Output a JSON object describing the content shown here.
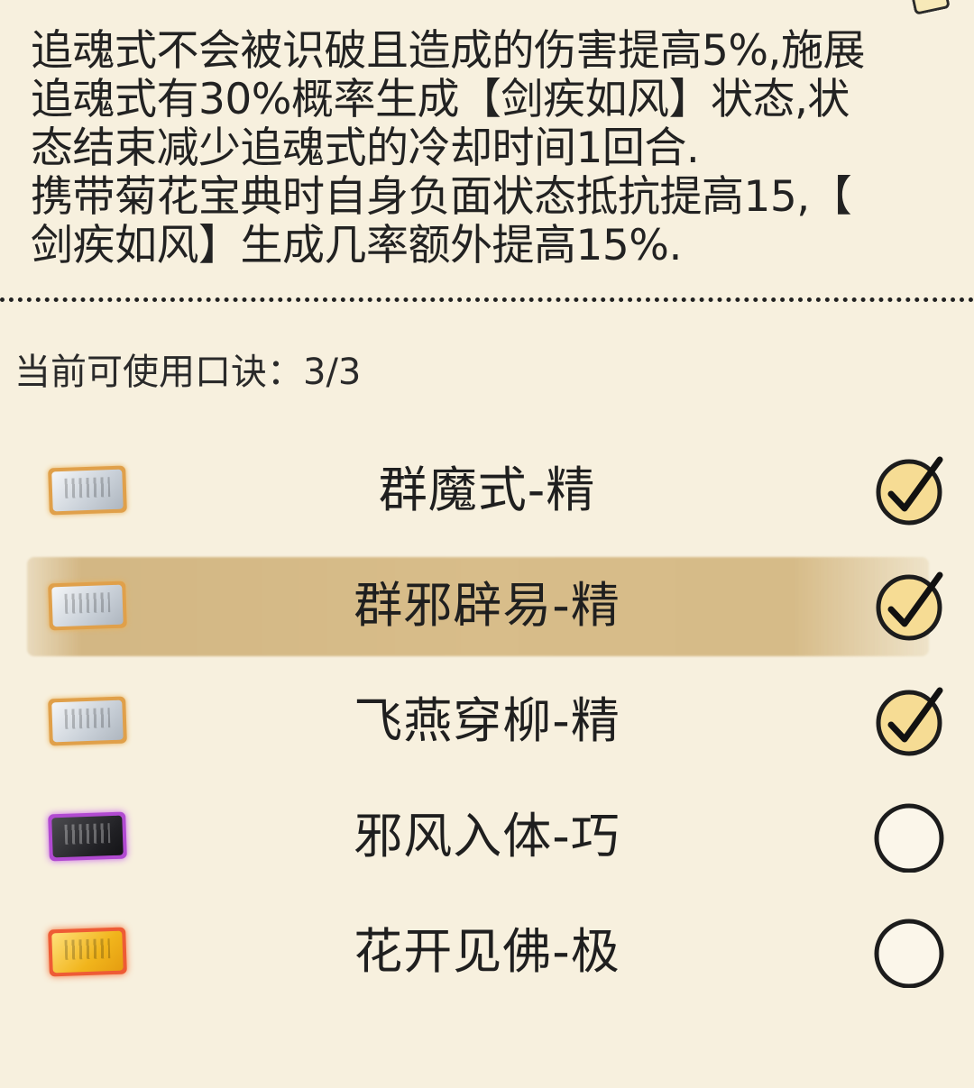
{
  "description": {
    "line1": "追魂式不会被识破且造成的伤害提高5%,施展",
    "line2": "追魂式有30%概率生成【剑疾如风】状态,状",
    "line3": "态结束减少追魂式的冷却时间1回合.",
    "line4": "携带菊花宝典时自身负面状态抵抗提高15,【",
    "line5": "剑疾如风】生成几率额外提高15%."
  },
  "status": {
    "label": "当前可使用口诀：",
    "value": "3/3"
  },
  "skills": [
    {
      "name": "群魔式-精",
      "tier_icon": "silver-tablet-icon",
      "checked": true,
      "highlighted": false
    },
    {
      "name": "群邪辟易-精",
      "tier_icon": "silver-tablet-icon",
      "checked": true,
      "highlighted": true
    },
    {
      "name": "飞燕穿柳-精",
      "tier_icon": "silver-tablet-icon",
      "checked": true,
      "highlighted": false
    },
    {
      "name": "邪风入体-巧",
      "tier_icon": "dark-tablet-icon",
      "checked": false,
      "highlighted": false
    },
    {
      "name": "花开见佛-极",
      "tier_icon": "gold-tablet-icon",
      "checked": false,
      "highlighted": false
    }
  ],
  "colors": {
    "background": "#f7f0de",
    "highlight": "#d6bb88",
    "check_fill": "#f6dc94",
    "rare_glow_silver": "#e0a04a",
    "rare_glow_dark": "#b14ad1",
    "rare_glow_gold": "#ee5b35"
  }
}
